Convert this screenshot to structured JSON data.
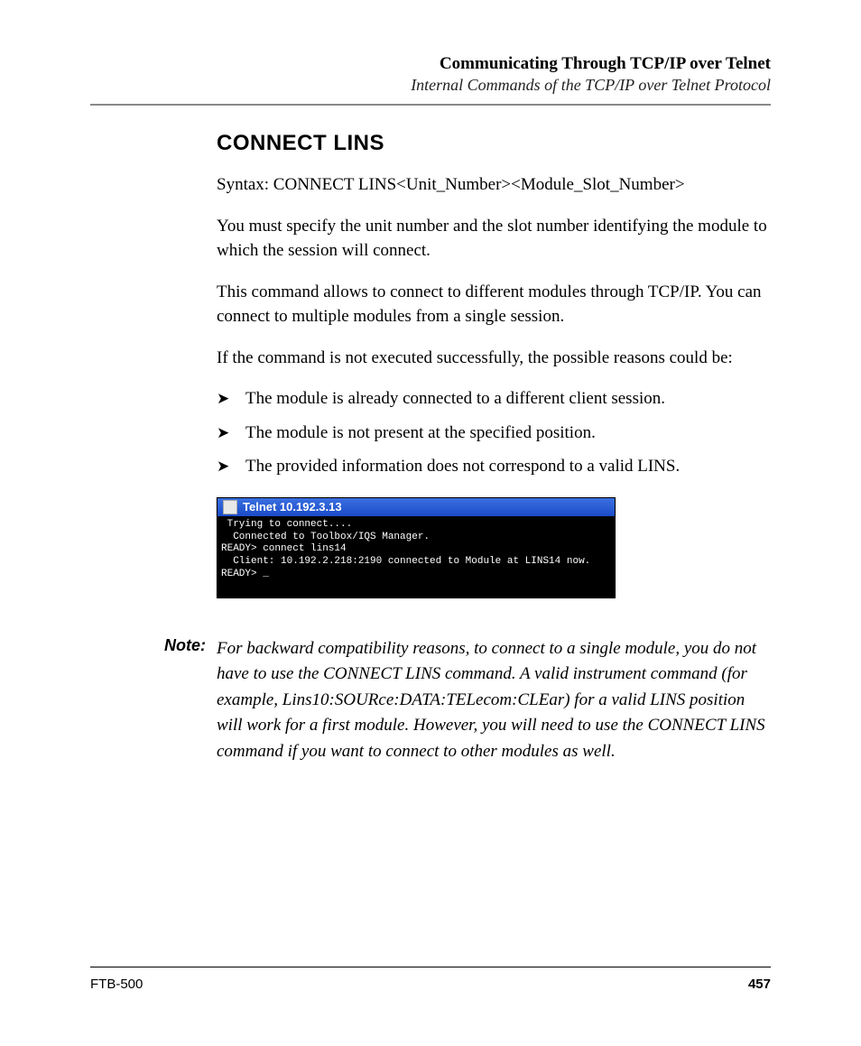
{
  "header": {
    "title": "Communicating Through TCP/IP over Telnet",
    "subtitle": "Internal Commands of the TCP/IP over Telnet Protocol"
  },
  "section": {
    "title": "CONNECT LINS",
    "syntax": "Syntax: CONNECT LINS<Unit_Number><Module_Slot_Number>",
    "p1": "You must specify the unit number and the slot number identifying the module to which the session will connect.",
    "p2": "This command allows to connect to different modules through TCP/IP. You can connect to multiple modules from a single session.",
    "p3": "If the command is not executed successfully, the possible reasons could be:",
    "bullets": [
      "The module is already connected to a different client session.",
      "The module is not present at the specified position.",
      "The provided information does not correspond to a valid LINS."
    ]
  },
  "terminal": {
    "title": "Telnet 10.192.3.13",
    "lines": [
      " Trying to connect....",
      "  Connected to Toolbox/IQS Manager.",
      "READY> connect lins14",
      "  Client: 10.192.2.218:2190 connected to Module at LINS14 now.",
      "READY> _"
    ]
  },
  "note": {
    "label": "Note:",
    "text": "For backward compatibility reasons, to connect to a single module, you do not have to use the CONNECT LINS command. A valid instrument command (for example, Lins10:SOURce:DATA:TELecom:CLEar) for a valid LINS position will work for a first module. However, you will need to use the CONNECT LINS command if you want to connect to other modules as well."
  },
  "footer": {
    "left": "FTB-500",
    "right": "457"
  }
}
